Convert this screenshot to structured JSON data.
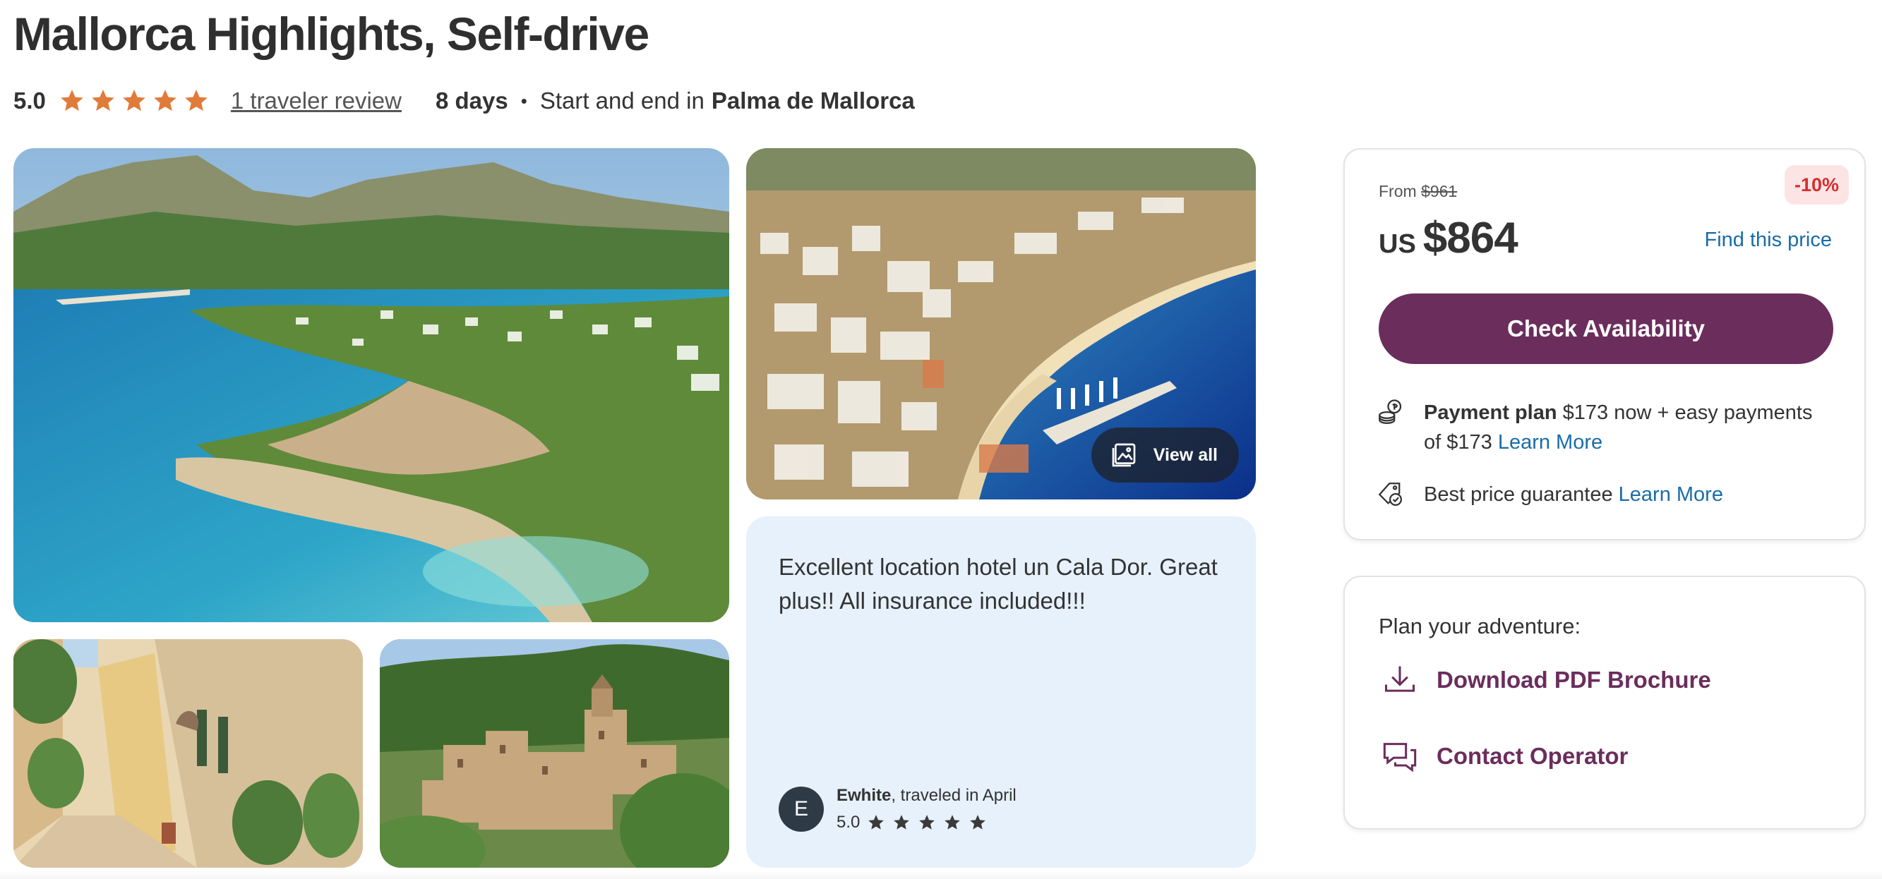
{
  "header": {
    "title": "Mallorca Highlights, Self-drive",
    "rating": "5.0",
    "review_link": "1 traveler review",
    "duration": "8 days",
    "dot": "•",
    "location_prefix": "Start and end in",
    "location_city": "Palma de Mallorca"
  },
  "gallery": {
    "view_all_label": "View all"
  },
  "review": {
    "text": "Excellent location hotel un Cala Dor. Great plus!! All insurance included!!!",
    "avatar_initial": "E",
    "reviewer_name": "Ewhite",
    "reviewer_meta": ", traveled in April",
    "rating": "5.0"
  },
  "pricing": {
    "from_label": "From",
    "old_price": "$961",
    "discount": "-10%",
    "currency": "US",
    "price": "$864",
    "find_price_link": "Find this price",
    "check_button": "Check Availability",
    "payment_plan_label": "Payment plan",
    "payment_plan_text": " $173 now + easy payments of $173 ",
    "payment_learn_more": "Learn More",
    "guarantee_text": "Best price guarantee ",
    "guarantee_learn_more": "Learn More"
  },
  "plan": {
    "title": "Plan your adventure:",
    "download_label": "Download PDF Brochure",
    "contact_label": "Contact Operator"
  },
  "colors": {
    "brand_purple": "#6b2d5c",
    "star_orange": "#e07b39",
    "link_blue": "#1a6ca8",
    "discount_red": "#d32f2f",
    "review_bg": "#e6f1fb"
  }
}
